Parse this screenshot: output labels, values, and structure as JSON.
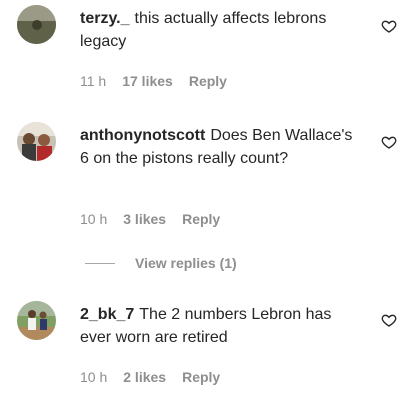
{
  "comments": [
    {
      "username": "terzy._",
      "text": "this actually affects lebrons legacy",
      "time": "11 h",
      "likes": "17 likes",
      "reply_label": "Reply"
    },
    {
      "username": "anthonynotscott",
      "text": "Does Ben Wallace's 6 on the pistons really count?",
      "time": "10 h",
      "likes": "3 likes",
      "reply_label": "Reply",
      "view_replies": "View replies (1)"
    },
    {
      "username": "2_bk_7",
      "text": "The 2 numbers Lebron has ever worn are retired",
      "time": "10 h",
      "likes": "2 likes",
      "reply_label": "Reply"
    }
  ],
  "icons": {
    "like": "heart-outline-icon"
  },
  "colors": {
    "text": "#262626",
    "muted": "#8e8e8e"
  }
}
